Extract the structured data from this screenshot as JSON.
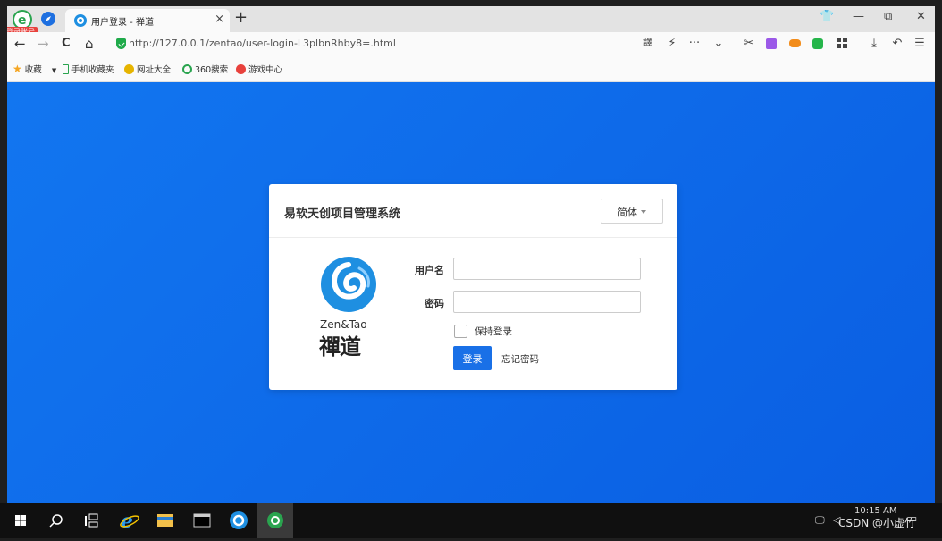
{
  "browser": {
    "login_badge": "登录账号",
    "tab": {
      "title": "用户登录 - 禅道",
      "close": "×"
    },
    "new_tab": "+",
    "window_controls": {
      "shirt": "👕",
      "minimize": "—",
      "restore": "⧉",
      "close": "✕"
    },
    "nav": {
      "back": "←",
      "forward": "→",
      "reload": "C",
      "home": "⌂"
    },
    "url": "http://127.0.0.1/zentao/user-login-L3plbnRhby8=.html",
    "url_icons": {
      "translate": "譯",
      "flash": "⚡",
      "more": "···",
      "dropdown": "⌄"
    },
    "right_icons": {
      "cut": "✂",
      "download": "⤓",
      "undo": "↶",
      "menu": "☰"
    },
    "bookmarks": [
      {
        "label": "收藏",
        "icon": "star-icon",
        "color": "#f5a623"
      },
      {
        "label": "手机收藏夹",
        "icon": "phone-icon",
        "color": "#2aa44f"
      },
      {
        "label": "网址大全",
        "icon": "globe-icon",
        "color": "#e6b400"
      },
      {
        "label": "360搜索",
        "icon": "search-icon",
        "color": "#2aa44f"
      },
      {
        "label": "游戏中心",
        "icon": "game-icon",
        "color": "#e8413c"
      }
    ]
  },
  "login": {
    "title": "易软天创项目管理系统",
    "language": "简体",
    "logo_en": "Zen&Tao",
    "logo_cn": "禪道",
    "username_label": "用户名",
    "username_value": "",
    "password_label": "密码",
    "password_value": "",
    "keep_login": "保持登录",
    "submit": "登录",
    "forgot": "忘记密码"
  },
  "taskbar": {
    "apps": [
      "windows-start",
      "search",
      "task-view",
      "internet-explorer",
      "file-explorer",
      "console",
      "zentao-app",
      "360-browser"
    ],
    "time": "10:15 AM"
  },
  "watermark": "CSDN @小虚竹",
  "colors": {
    "page_bg": "#0a62e6",
    "primary_button": "#1970e7",
    "tab_bg": "#fafafa"
  }
}
